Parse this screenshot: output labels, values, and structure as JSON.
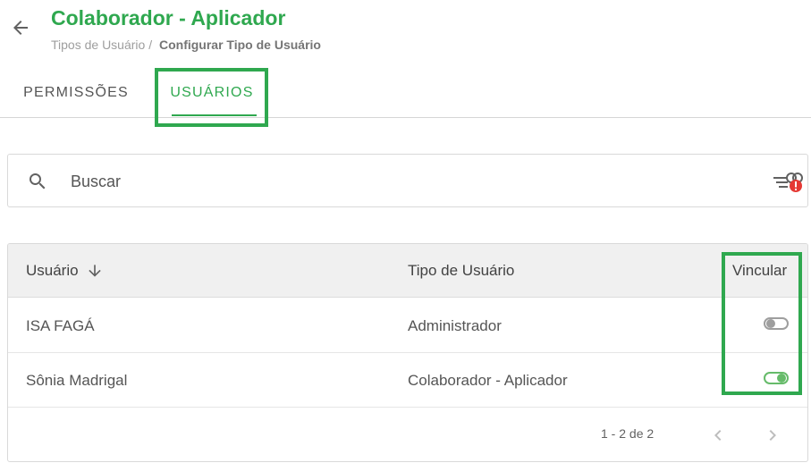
{
  "header": {
    "title": "Colaborador - Aplicador",
    "breadcrumb": {
      "parent": "Tipos de Usuário /",
      "current": "Configurar Tipo de Usuário"
    }
  },
  "tabs": [
    {
      "label": "PERMISSÕES",
      "active": false
    },
    {
      "label": "USUÁRIOS",
      "active": true
    }
  ],
  "search": {
    "placeholder": "Buscar",
    "value": ""
  },
  "table": {
    "columns": {
      "user": "Usuário",
      "type": "Tipo de Usuário",
      "link": "Vincular"
    },
    "sort": {
      "column": "user",
      "direction": "desc"
    },
    "rows": [
      {
        "name": "ISA FAGÁ",
        "type": "Administrador",
        "linked": false
      },
      {
        "name": "Sônia Madrigal",
        "type": "Colaborador - Aplicador",
        "linked": true
      }
    ]
  },
  "pagination": {
    "range": "1 - 2 de 2"
  },
  "icons": {
    "back": "arrow-left-icon",
    "search": "search-icon",
    "filter": "filter-alert-icon",
    "sort": "arrow-down-icon",
    "prev": "chevron-left-icon",
    "next": "chevron-right-icon"
  },
  "colors": {
    "brand": "#2fa84f",
    "toggle_on": "#66bb6a",
    "toggle_off": "#9e9e9e",
    "alert": "#e53935"
  }
}
